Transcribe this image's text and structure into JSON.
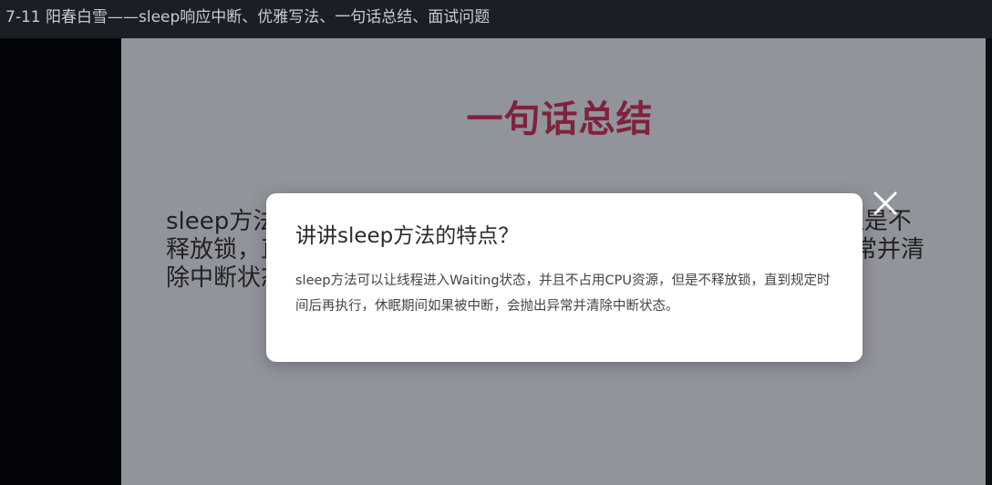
{
  "window": {
    "title": "7-11 阳春白雪——sleep响应中断、优雅写法、一句话总结、面试问题"
  },
  "slide": {
    "title": "一句话总结",
    "body": "sleep方法可以让线程进入Waiting状态，并且不占用CPU资源，但是不释放锁，直到规定时间后再执行，休眠期间如果被中断，会抛出异常并清除中断状态。"
  },
  "modal": {
    "question": "讲讲sleep方法的特点？",
    "answer": "sleep方法可以让线程进入Waiting状态，并且不占用CPU资源，但是不释放锁，直到规定时间后再执行，休眠期间如果被中断，会抛出异常并清除中断状态。",
    "close_icon": "close-icon"
  },
  "colors": {
    "slide_title": "#7a1a35",
    "slide_background": "#8e9097",
    "modal_background": "#ffffff"
  }
}
